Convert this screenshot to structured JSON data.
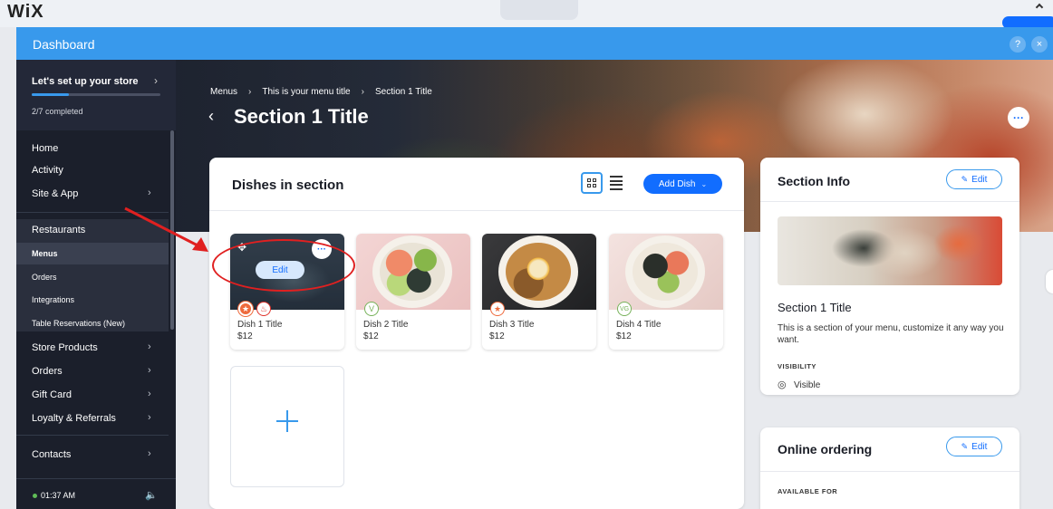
{
  "topbar": {
    "logo": "WiX"
  },
  "window": {
    "title": "Dashboard",
    "help_label": "?",
    "close_label": "×"
  },
  "sidebar": {
    "setup": {
      "title": "Let's set up your store",
      "progress_text": "2/7 completed",
      "progress": 0.29
    },
    "items": [
      {
        "label": "Home"
      },
      {
        "label": "Activity"
      },
      {
        "label": "Site & App"
      },
      {
        "label": "Restaurants"
      },
      {
        "label": "Menus"
      },
      {
        "label": "Orders"
      },
      {
        "label": "Integrations"
      },
      {
        "label": "Table Reservations (New)"
      },
      {
        "label": "Store Products"
      },
      {
        "label": "Orders"
      },
      {
        "label": "Gift Card"
      },
      {
        "label": "Loyalty & Referrals"
      },
      {
        "label": "Contacts"
      }
    ],
    "time": "01:37 AM"
  },
  "header": {
    "breadcrumbs": [
      "Menus",
      "This is your menu title",
      "Section 1 Title"
    ],
    "title": "Section 1 Title"
  },
  "dishes": {
    "title": "Dishes in section",
    "add_button": "Add Dish",
    "edit_label": "Edit",
    "items": [
      {
        "name": "Dish 1 Title",
        "price": "$12"
      },
      {
        "name": "Dish 2 Title",
        "price": "$12"
      },
      {
        "name": "Dish 3 Title",
        "price": "$12"
      },
      {
        "name": "Dish 4 Title",
        "price": "$12"
      }
    ]
  },
  "section_info": {
    "title": "Section Info",
    "edit_label": "Edit",
    "name": "Section 1 Title",
    "description": "This is a section of your menu, customize it any way you want.",
    "visibility_label": "VISIBILITY",
    "visibility_value": "Visible"
  },
  "online_ordering": {
    "title": "Online ordering",
    "edit_label": "Edit",
    "available_label": "AVAILABLE FOR"
  },
  "colors": {
    "accent": "#116dff",
    "header": "#3899ec",
    "sidebar": "#1b1f2b",
    "annotation": "#e02020"
  }
}
